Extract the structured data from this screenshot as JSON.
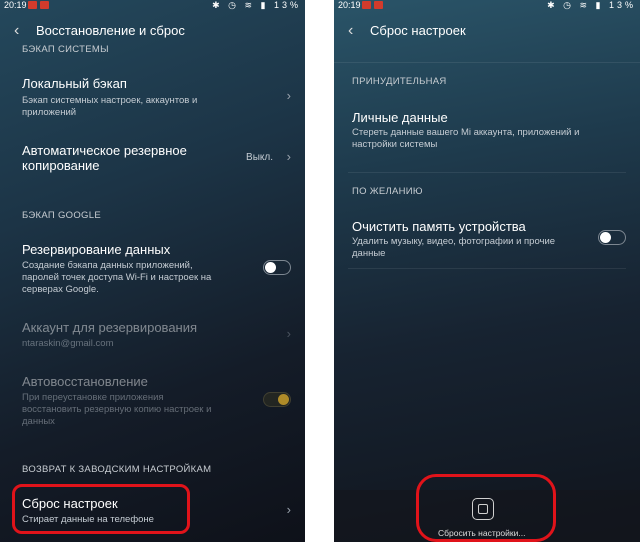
{
  "left": {
    "status": {
      "time": "20:19",
      "battery": "13%"
    },
    "title": "Восстановление и сброс",
    "sections": {
      "system_backup": "БЭКАП СИСТЕМЫ",
      "google_backup": "БЭКАП GOOGLE",
      "factory": "ВОЗВРАТ К ЗАВОДСКИМ НАСТРОЙКАМ"
    },
    "items": {
      "local_backup": {
        "title": "Локальный бэкап",
        "subtitle_1": "Бэкап системных настроек, аккаунтов и",
        "subtitle_2": "приложений"
      },
      "auto_backup": {
        "title_1": "Автоматическое резервное",
        "title_2": "копирование",
        "value": "Выкл."
      },
      "data_backup": {
        "title": "Резервирование данных",
        "subtitle_1": "Создание бэкапа данных приложений,",
        "subtitle_2": "паролей точек доступа Wi-Fi и настроек на",
        "subtitle_3": "серверах Google."
      },
      "backup_account": {
        "title": "Аккаунт для резервирования",
        "subtitle": "ntaraskin@gmail.com"
      },
      "auto_restore": {
        "title": "Автовосстановление",
        "subtitle_1": "При переустановке приложения",
        "subtitle_2": "восстановить резервную копию настроек и",
        "subtitle_3": "данных"
      },
      "reset": {
        "title": "Сброс настроек",
        "subtitle": "Стирает данные на телефоне"
      }
    },
    "toggles": {
      "data_backup": "off",
      "auto_restore": "on"
    }
  },
  "right": {
    "status": {
      "time": "20:19",
      "battery": "13%"
    },
    "title": "Сброс настроек",
    "sections": {
      "forced": "ПРИНУДИТЕЛЬНАЯ",
      "optional": "ПО ЖЕЛАНИЮ"
    },
    "items": {
      "personal_data": {
        "title": "Личные данные",
        "subtitle_1": "Стереть данные вашего Mi аккаунта, приложений и",
        "subtitle_2": "настройки системы"
      },
      "clear_memory": {
        "title": "Очистить память устройства",
        "subtitle_1": "Удалить музыку, видео, фотографии и прочие",
        "subtitle_2": "данные"
      }
    },
    "toggles": {
      "clear_memory": "off"
    },
    "reset_button_label": "Сбросить настройки..."
  },
  "colors": {
    "highlight": "#e0131a",
    "toggle_on": "#d6a82a"
  }
}
